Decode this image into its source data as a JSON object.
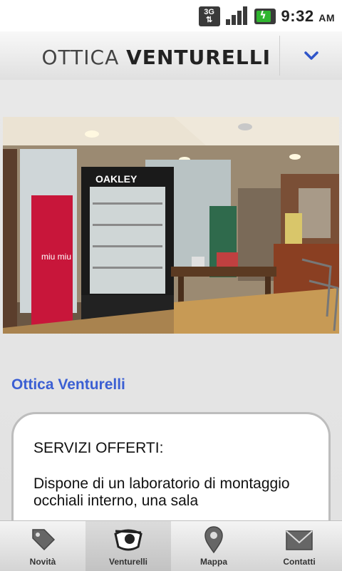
{
  "status": {
    "net": "3G",
    "time": "9:32",
    "ampm": "AM"
  },
  "header": {
    "title_light": "OTTICA",
    "title_bold": "VENTURELLI",
    "menu_icon": "chevron-down-icon"
  },
  "main": {
    "photo": {
      "brand_sign": "OAKLEY",
      "poster_brand": "miu miu",
      "alt": ""
    },
    "shop_title": "Ottica Venturelli",
    "card": {
      "heading": "SERVIZI OFFERTI:",
      "paragraph": "Dispone di un laboratorio di montaggio occhiali interno, una sala"
    }
  },
  "tabs": [
    {
      "label": "Novità",
      "icon": "tag-icon"
    },
    {
      "label": "Venturelli",
      "icon": "eye-icon"
    },
    {
      "label": "Mappa",
      "icon": "map-pin-icon"
    },
    {
      "label": "Contatti",
      "icon": "envelope-icon"
    }
  ],
  "colors": {
    "accent": "#3b5fd3",
    "battery": "#2fb52f"
  }
}
